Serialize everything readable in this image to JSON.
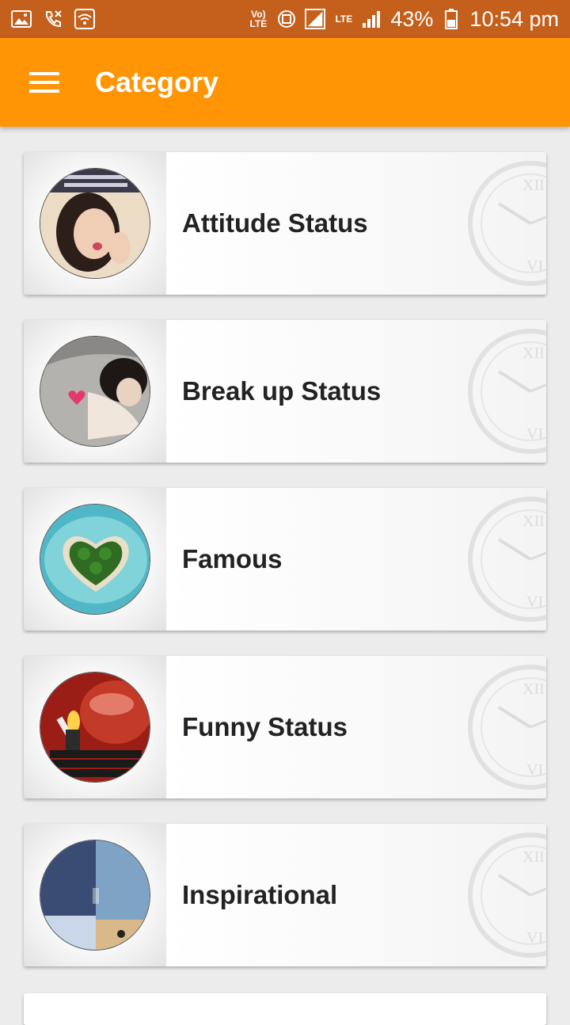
{
  "status_bar": {
    "signal_text": "LTE",
    "volte_text": "Vo) LTE",
    "battery": "43%",
    "time": "10:54 pm",
    "icons": [
      "image-icon",
      "missed-call-icon",
      "wifi-icon",
      "volte-icon",
      "data-icon",
      "signal-icon",
      "battery-icon"
    ]
  },
  "app_bar": {
    "title": "Category",
    "menu_icon": "hamburger-icon",
    "color": "#ff9505"
  },
  "categories": [
    {
      "label": "Attitude Status",
      "image": "girl-pout-thumbnail"
    },
    {
      "label": "Break up Status",
      "image": "broken-heart-thumbnail"
    },
    {
      "label": "Famous",
      "image": "heart-island-thumbnail"
    },
    {
      "label": "Funny Status",
      "image": "lighter-thumbnail"
    },
    {
      "label": "Inspirational",
      "image": "inspirational-thumbnail"
    }
  ]
}
